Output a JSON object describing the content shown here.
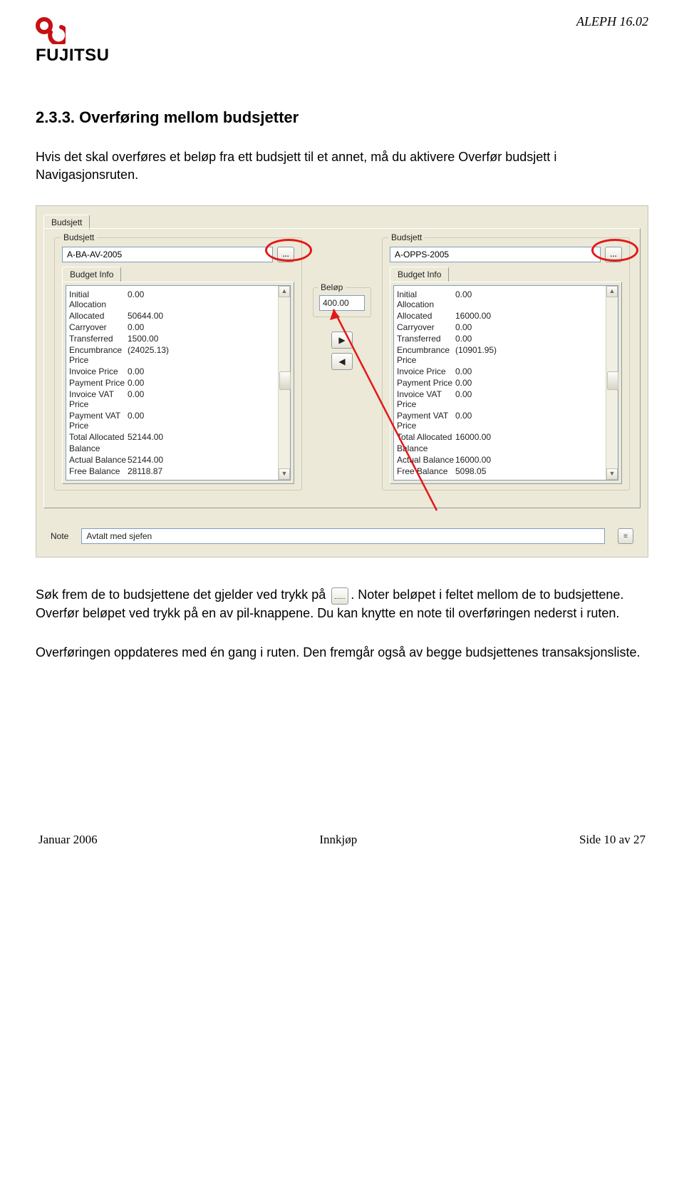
{
  "header": {
    "logo_text": "FUJITSU",
    "right": "ALEPH 16.02"
  },
  "heading": "2.3.3.  Overføring mellom budsjetter",
  "para1": "Hvis det skal overføres et beløp fra ett budsjett til et annet, må du aktivere Overfør budsjett i Navigasjonsruten.",
  "para2a": "Søk frem de to budsjettene det gjelder ved trykk på ",
  "para2b": ". Noter beløpet i feltet mellom de to budsjettene. Overfør beløpet ved trykk på en av pil-knappene. Du kan knytte en note til overføringen nederst i ruten.",
  "para3": "Overføringen oppdateres med én gang i ruten. Den fremgår også av begge budsjettenes transaksjonsliste.",
  "ui": {
    "top_tab": "Budsjett",
    "col_legend": "Budsjett",
    "sub_tab": "Budget Info",
    "left_code": "A-BA-AV-2005",
    "right_code": "A-OPPS-2005",
    "rows_left": [
      {
        "k": "Initial Allocation",
        "v": "0.00"
      },
      {
        "k": "Allocated",
        "v": "50644.00"
      },
      {
        "k": "Carryover",
        "v": "0.00"
      },
      {
        "k": "Transferred",
        "v": "1500.00"
      },
      {
        "k": "Encumbrance Price",
        "v": "(24025.13)"
      },
      {
        "k": "Invoice Price",
        "v": "0.00"
      },
      {
        "k": "Payment Price",
        "v": "0.00"
      },
      {
        "k": "Invoice VAT Price",
        "v": "0.00"
      },
      {
        "k": "Payment VAT Price",
        "v": "0.00"
      },
      {
        "k": "Total Allocated",
        "v": "52144.00"
      },
      {
        "k": "Balance",
        "v": ""
      },
      {
        "k": "Actual Balance",
        "v": "52144.00"
      },
      {
        "k": "Free Balance",
        "v": "28118.87"
      }
    ],
    "rows_right": [
      {
        "k": "Initial Allocation",
        "v": "0.00"
      },
      {
        "k": "Allocated",
        "v": "16000.00"
      },
      {
        "k": "Carryover",
        "v": "0.00"
      },
      {
        "k": "Transferred",
        "v": "0.00"
      },
      {
        "k": "Encumbrance Price",
        "v": "(10901.95)"
      },
      {
        "k": "Invoice Price",
        "v": "0.00"
      },
      {
        "k": "Payment Price",
        "v": "0.00"
      },
      {
        "k": "Invoice VAT Price",
        "v": "0.00"
      },
      {
        "k": "Payment VAT Price",
        "v": "0.00"
      },
      {
        "k": "Total Allocated",
        "v": "16000.00"
      },
      {
        "k": "Balance",
        "v": ""
      },
      {
        "k": "Actual Balance",
        "v": "16000.00"
      },
      {
        "k": "Free Balance",
        "v": "5098.05"
      }
    ],
    "belop_label": "Beløp",
    "belop_value": "400.00",
    "note_label": "Note",
    "note_value": "Avtalt med sjefen"
  },
  "footer": {
    "left": "Januar 2006",
    "center": "Innkjøp",
    "right": "Side 10 av 27"
  }
}
